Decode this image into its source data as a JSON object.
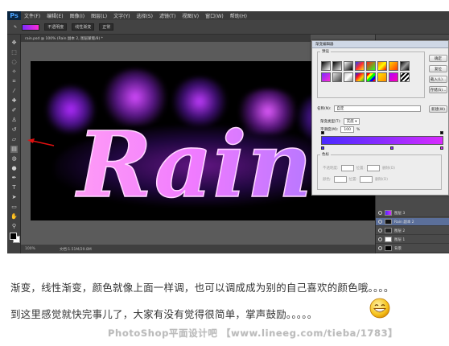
{
  "app": {
    "logo": "Ps",
    "menus": [
      "文件(F)",
      "编辑(E)",
      "图像(I)",
      "图层(L)",
      "文字(Y)",
      "选择(S)",
      "滤镜(T)",
      "视图(V)",
      "窗口(W)",
      "帮助(H)"
    ],
    "options": [
      "不透明度",
      "线性渐变",
      "正常"
    ],
    "doc_tab": "rain.psd @ 100% (Rain 副本 2, 图层蒙版/8) *",
    "status": [
      "100%",
      "文档:1.51M/29.8M"
    ]
  },
  "artwork": {
    "text": "Rain"
  },
  "gradient_editor": {
    "title": "渐变编辑器",
    "presets_label": "预设",
    "buttons": [
      "确定",
      "复位",
      "载入(L)...",
      "存储(S)..."
    ],
    "new_button": "新建(W)",
    "name_label": "名称(N):",
    "name_value": "自定",
    "type_label": "渐变类型(T):",
    "type_value": "实底",
    "smooth_label": "平滑度(M):",
    "smooth_value": "100",
    "smooth_unit": "%",
    "stops_label": "色标",
    "opacity_label": "不透明度:",
    "location_label": "位置:",
    "delete_label": "删除(D)",
    "color_label": "颜色:",
    "colors": {
      "start": "#4a2aff",
      "mid": "#8a2cff",
      "end": "#d92bff"
    }
  },
  "layers": [
    {
      "name": "图层 3"
    },
    {
      "name": "Rain 副本 2"
    },
    {
      "name": "图层 2"
    },
    {
      "name": "图层 1"
    },
    {
      "name": "背景"
    }
  ],
  "captions": {
    "line1": "渐变，线性渐变，颜色就像上面一样调，也可以调成成为别的自己喜欢的颜色哦。。。。",
    "line2": "到这里感觉就快完事儿了，大家有没有觉得很简单，掌声鼓励。。。。。"
  },
  "watermark": "PhotoShop平面设计吧 【www.lineeg.com/tieba/1783】"
}
